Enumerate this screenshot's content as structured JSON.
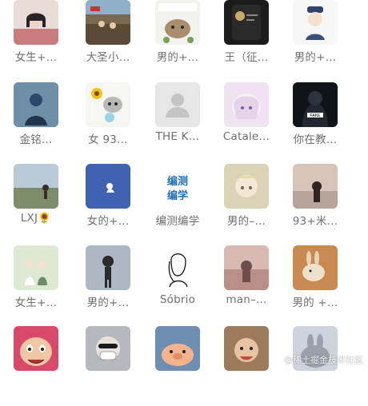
{
  "contacts": [
    {
      "name": "女生+…",
      "icon": "girl-photo-avatar",
      "bg": "#e9dcd6"
    },
    {
      "name": "大圣小…",
      "icon": "street-photo-avatar",
      "bg": "#7a6a52"
    },
    {
      "name": "男的+…",
      "icon": "cartoon-bear-avatar",
      "bg": "#f2f2ee"
    },
    {
      "name": "王（征…",
      "icon": "dark-phone-avatar",
      "bg": "#1c1c1c"
    },
    {
      "name": "男的+…",
      "icon": "cartoon-boy-avatar",
      "bg": "#f7f7f7"
    },
    {
      "name": "金铭…",
      "icon": "blue-figure-avatar",
      "bg": "#3c5a78"
    },
    {
      "name": "女 93…",
      "icon": "cat-sunflower-avatar",
      "bg": "#f5f6f2"
    },
    {
      "name": "THE K…",
      "icon": "default-person-avatar",
      "bg": "#e6e6e6"
    },
    {
      "name": "Catale…",
      "icon": "anime-girl-avatar",
      "bg": "#efe3f2"
    },
    {
      "name": "你在教…",
      "icon": "fake-hoodie-avatar",
      "bg": "#101318"
    },
    {
      "name": "LXJ🌻",
      "icon": "landscape-girl-avatar",
      "bg": "#c9d6cc"
    },
    {
      "name": "女的+…",
      "icon": "blue-card-avatar",
      "bg": "#3f63b1"
    },
    {
      "name": "编测编学",
      "icon": "text-logo-avatar",
      "bg": "#ffffff"
    },
    {
      "name": "男的–…",
      "icon": "anime-boy-avatar",
      "bg": "#d9d4b6"
    },
    {
      "name": "93+米…",
      "icon": "sunset-girl-avatar",
      "bg": "#d8c3b8"
    },
    {
      "name": "女生+…",
      "icon": "wedding-illust-avatar",
      "bg": "#dfe8d3"
    },
    {
      "name": "男的+…",
      "icon": "sketch-boy-avatar",
      "bg": "#aeb7c4"
    },
    {
      "name": "Sóbrio",
      "icon": "line-drawing-girl-avatar",
      "bg": "#ffffff"
    },
    {
      "name": "man–…",
      "icon": "pink-mood-avatar",
      "bg": "#d9b9b2"
    },
    {
      "name": "男的 +…",
      "icon": "rabbit-autumn-avatar",
      "bg": "#c98a52"
    },
    {
      "name": "",
      "icon": "funny-face-avatar",
      "bg": "#d94a6a"
    },
    {
      "name": "",
      "icon": "masked-man-avatar",
      "bg": "#b7b7be"
    },
    {
      "name": "",
      "icon": "cartoon-pig-avatar",
      "bg": "#6e8fb1"
    },
    {
      "name": "",
      "icon": "baby-photo-avatar",
      "bg": "#9c7a5c"
    },
    {
      "name": "",
      "icon": "rabbit-gray-avatar",
      "bg": "#cfd4dc"
    }
  ],
  "watermark": "@稀土掘金技术社区"
}
